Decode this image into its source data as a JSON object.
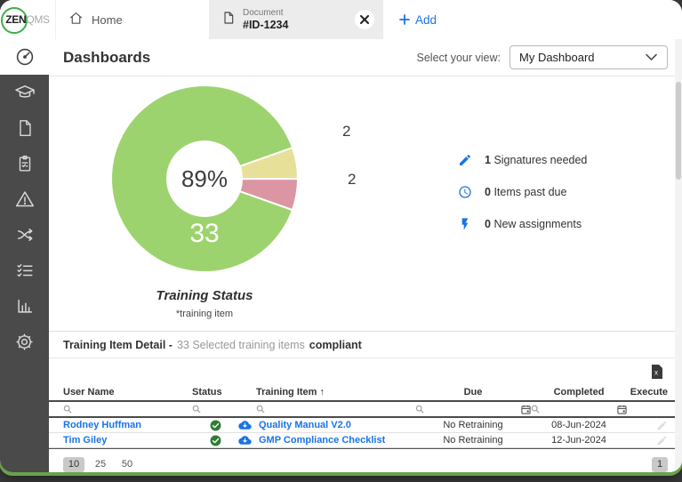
{
  "topbar": {
    "logo": {
      "zen": "ZEN",
      "qms": "QMS"
    },
    "home_label": "Home",
    "doc_tab": {
      "kicker": "Document",
      "id": "#ID-1234"
    },
    "add_label": "Add"
  },
  "sidebar": {
    "items": [
      {
        "icon": "gauge-icon",
        "active": true
      },
      {
        "icon": "graduation-cap-icon",
        "active": false
      },
      {
        "icon": "document-icon",
        "active": false
      },
      {
        "icon": "clipboard-check-icon",
        "active": false
      },
      {
        "icon": "warning-triangle-icon",
        "active": false
      },
      {
        "icon": "shuffle-icon",
        "active": false
      },
      {
        "icon": "task-list-icon",
        "active": false
      },
      {
        "icon": "bar-chart-icon",
        "active": false
      },
      {
        "icon": "gear-icon",
        "active": false
      }
    ]
  },
  "header": {
    "title": "Dashboards",
    "view_label": "Select your view:",
    "view_value": "My Dashboard"
  },
  "chart_data": {
    "type": "pie",
    "title": "Training Status",
    "footnote": "*training item",
    "center_label": "89%",
    "start_angle_deg": 109.5,
    "outer_radius": 105,
    "inner_radius": 42,
    "slices": [
      {
        "name": "compliant",
        "value": 33,
        "color": "#9dd36e",
        "label_pos": "inside"
      },
      {
        "name": "slice-yellow",
        "value": 2,
        "color": "#e6e099",
        "label_pos": "outside"
      },
      {
        "name": "slice-pink",
        "value": 2,
        "color": "#dc96a3",
        "label_pos": "outside"
      }
    ]
  },
  "stats": [
    {
      "icon": "pencil-icon",
      "count": "1",
      "label": "Signatures needed"
    },
    {
      "icon": "clock-icon",
      "count": "0",
      "label": "Items past due"
    },
    {
      "icon": "lightning-icon",
      "count": "0",
      "label": "New assignments"
    }
  ],
  "detail": {
    "title_bold": "Training Item Detail -",
    "count_text": "33 Selected training items",
    "status_text": "compliant"
  },
  "table": {
    "columns": [
      "User Name",
      "Status",
      "Training Item",
      "Due",
      "Completed",
      "Execute"
    ],
    "sort_indicator": "↑",
    "rows": [
      {
        "user": "Rodney Huffman",
        "status": "compliant-check",
        "doc_icon": "cloud-download-icon",
        "item": "Quality Manual V2.0",
        "due": "No Retraining",
        "completed": "08-Jun-2024"
      },
      {
        "user": "Tim Giley",
        "status": "compliant-check",
        "doc_icon": "cloud-download-icon",
        "item": "GMP Compliance Checklist",
        "due": "No Retraining",
        "completed": "12-Jun-2024"
      }
    ]
  },
  "pagination": {
    "page_sizes": [
      "10",
      "25",
      "50"
    ],
    "active_size": "10",
    "current_page": "1"
  },
  "colors": {
    "brand_blue": "#1a73e8",
    "sidebar_gray": "#4a4a4a",
    "check_green": "#2e7d32",
    "pie_green": "#9dd36e",
    "pie_yellow": "#e6e099",
    "pie_pink": "#dc96a3"
  }
}
